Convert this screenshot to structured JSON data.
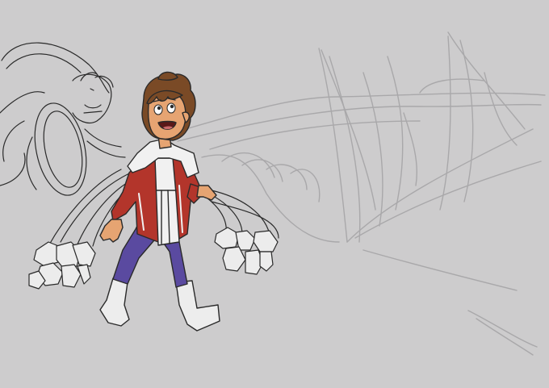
{
  "image": {
    "background_color": "#cdcccd",
    "colors": {
      "line_dark": "#2a2a2a",
      "sketch_light": "#a9a8aa",
      "skin": "#e6a472",
      "hair": "#7a4a26",
      "jacket_red": "#b3352b",
      "white_cloth": "#f1f1f1",
      "pants_purple": "#5a4aa0",
      "boot": "#ededed",
      "mouth": "#5a1818",
      "tongue": "#c96a6a"
    }
  }
}
